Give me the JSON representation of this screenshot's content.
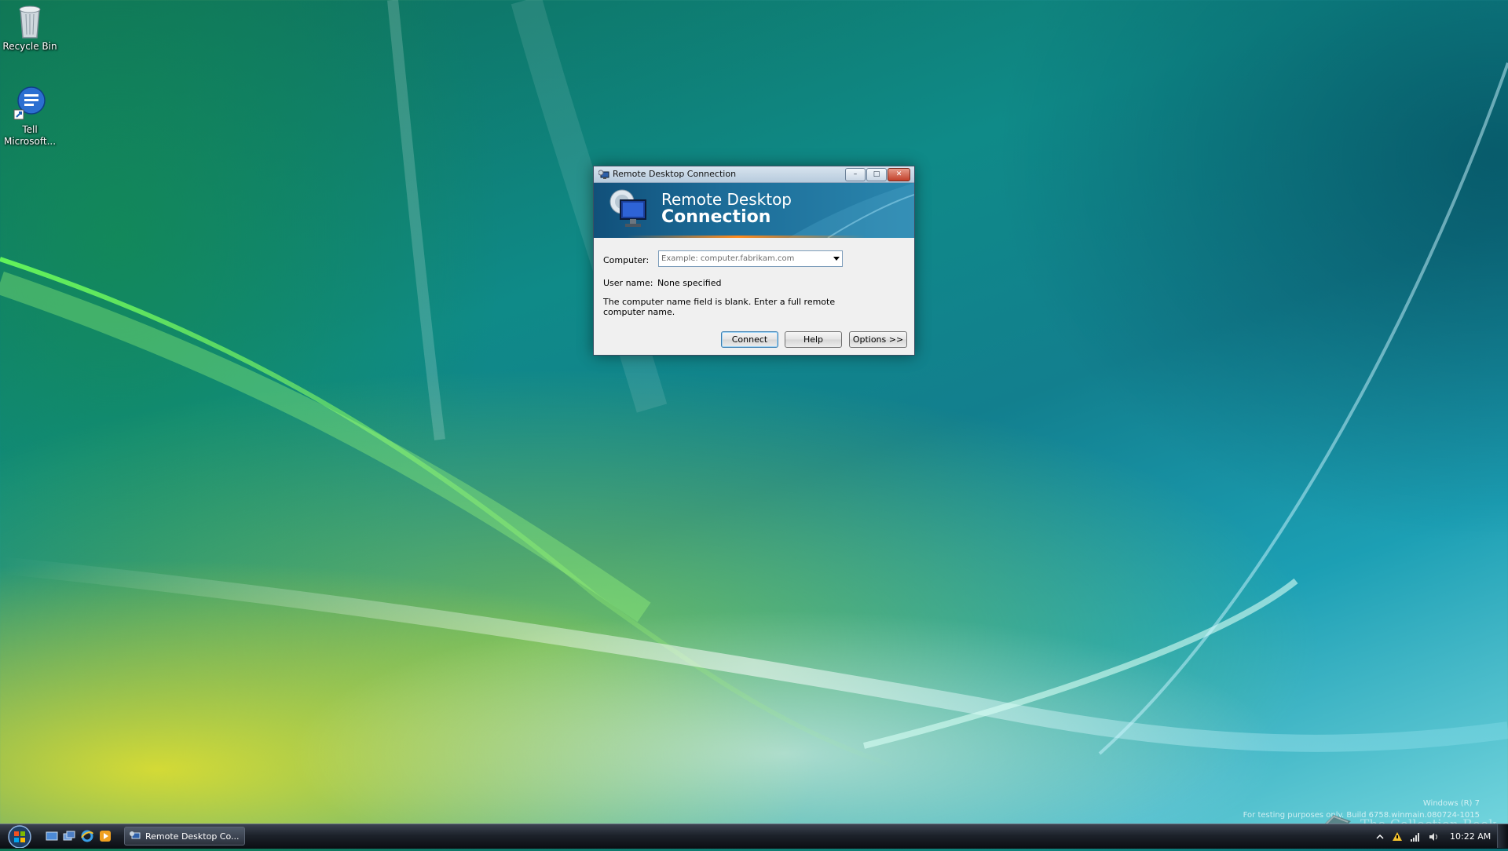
{
  "desktop": {
    "icons": [
      {
        "label": "Recycle Bin",
        "icon": "recycle-bin-icon"
      },
      {
        "label": "Tell Microsoft...",
        "icon": "tell-microsoft-icon"
      }
    ],
    "watermark": {
      "line1": "Windows (R) 7",
      "line2": "For testing purposes only. Build 6758.winmain.080724-1015"
    },
    "overlay_text": "The Collection Book"
  },
  "dialog": {
    "title": "Remote Desktop Connection",
    "banner": {
      "line1": "Remote Desktop",
      "line2": "Connection"
    },
    "computer_label": "Computer:",
    "computer_placeholder": "Example: computer.fabrikam.com",
    "computer_value": "",
    "username_label": "User name:",
    "username_value": "None specified",
    "message": "The computer name field is blank. Enter a full remote computer name.",
    "buttons": {
      "connect": "Connect",
      "help": "Help",
      "options": "Options >>"
    },
    "window_controls": {
      "minimize": "–",
      "maximize": "□",
      "close": "✕"
    }
  },
  "taskbar": {
    "quick_launch": [
      "show-desktop-icon",
      "switch-windows-icon",
      "internet-explorer-icon",
      "media-player-icon"
    ],
    "active_task": "Remote Desktop Co...",
    "clock": "10:22 AM",
    "tray_icons": [
      "show-hidden-icons-icon",
      "action-center-icon",
      "network-icon",
      "volume-icon"
    ]
  },
  "colors": {
    "accent": "#1c6c98",
    "banner_orange": "#ff8a1c",
    "taskbar": "#1d222b"
  }
}
